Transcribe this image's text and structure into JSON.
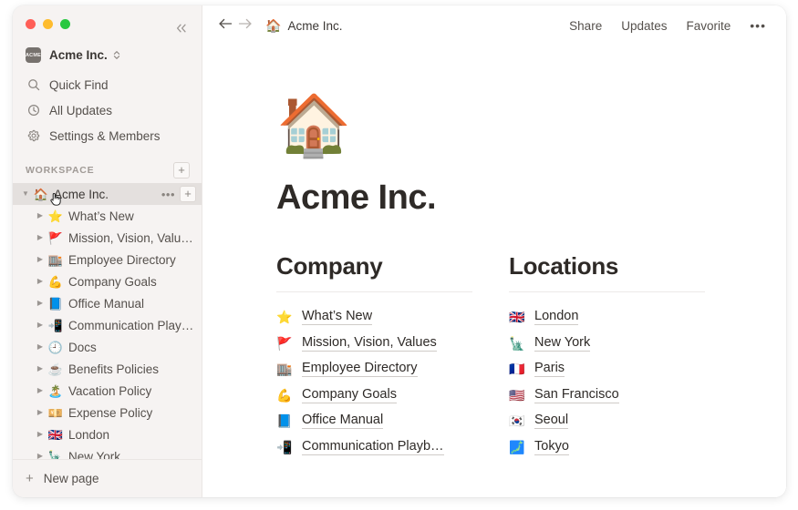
{
  "window": {
    "traffic_lights": [
      "close",
      "minimize",
      "maximize"
    ],
    "colors": {
      "close": "#FF5F57",
      "minimize": "#FEBC2E",
      "maximize": "#28C840",
      "sidebar_bg": "#F6F3F2",
      "main_bg": "#FFFFFF",
      "selected_row": "#E4E0DE",
      "text_primary": "#3B3734",
      "text_muted": "#A09A96"
    }
  },
  "sidebar": {
    "collapse_icon": "chevrons-left-icon",
    "workspace_switcher": {
      "badge_text": "ACME",
      "name": "Acme Inc.",
      "caret_icon": "chevron-up-down-icon"
    },
    "nav_items": [
      {
        "icon": "search-icon",
        "label": "Quick Find"
      },
      {
        "icon": "clock-icon",
        "label": "All Updates"
      },
      {
        "icon": "gear-icon",
        "label": "Settings & Members"
      }
    ],
    "section": {
      "title": "WORKSPACE",
      "add_label": "+"
    },
    "tree": [
      {
        "emoji": "🏠",
        "label": "Acme Inc.",
        "selected": true,
        "level": 0,
        "twisty": "▼",
        "actions": {
          "more": "•••",
          "add": "+"
        }
      },
      {
        "emoji": "⭐",
        "label": "What’s New",
        "selected": false,
        "level": 1,
        "twisty": "▶"
      },
      {
        "emoji": "🚩",
        "label": "Mission, Vision, Valu…",
        "selected": false,
        "level": 1,
        "twisty": "▶"
      },
      {
        "emoji": "🏬",
        "label": "Employee Directory",
        "selected": false,
        "level": 1,
        "twisty": "▶"
      },
      {
        "emoji": "💪",
        "label": "Company Goals",
        "selected": false,
        "level": 1,
        "twisty": "▶"
      },
      {
        "emoji": "📘",
        "label": "Office Manual",
        "selected": false,
        "level": 1,
        "twisty": "▶"
      },
      {
        "emoji": "📲",
        "label": "Communication Play…",
        "selected": false,
        "level": 1,
        "twisty": "▶"
      },
      {
        "emoji": "🕘",
        "label": "Docs",
        "selected": false,
        "level": 1,
        "twisty": "▶"
      },
      {
        "emoji": "☕",
        "label": "Benefits Policies",
        "selected": false,
        "level": 1,
        "twisty": "▶"
      },
      {
        "emoji": "🏝️",
        "label": "Vacation Policy",
        "selected": false,
        "level": 1,
        "twisty": "▶"
      },
      {
        "emoji": "💴",
        "label": "Expense Policy",
        "selected": false,
        "level": 1,
        "twisty": "▶"
      },
      {
        "emoji": "🇬🇧",
        "label": "London",
        "selected": false,
        "level": 1,
        "twisty": "▶"
      },
      {
        "emoji": "🗽",
        "label": "New York",
        "selected": false,
        "level": 1,
        "twisty": "▶"
      }
    ],
    "footer": {
      "icon": "plus-icon",
      "label": "New page"
    }
  },
  "topbar": {
    "back_icon": "arrow-left-icon",
    "forward_icon": "arrow-right-icon",
    "breadcrumb": {
      "emoji": "🏠",
      "label": "Acme Inc."
    },
    "actions": [
      "Share",
      "Updates",
      "Favorite"
    ],
    "more_icon": "•••"
  },
  "page": {
    "icon": "🏠",
    "title": "Acme Inc.",
    "columns": [
      {
        "heading": "Company",
        "links": [
          {
            "emoji": "⭐",
            "label": "What’s New"
          },
          {
            "emoji": "🚩",
            "label": "Mission, Vision, Values"
          },
          {
            "emoji": "🏬",
            "label": "Employee Directory"
          },
          {
            "emoji": "💪",
            "label": "Company Goals"
          },
          {
            "emoji": "📘",
            "label": "Office Manual"
          },
          {
            "emoji": "📲",
            "label": "Communication Playb…"
          }
        ]
      },
      {
        "heading": "Locations",
        "links": [
          {
            "emoji": "🇬🇧",
            "label": "London"
          },
          {
            "emoji": "🗽",
            "label": "New York"
          },
          {
            "emoji": "🇫🇷",
            "label": "Paris"
          },
          {
            "emoji": "🇺🇸",
            "label": "San Francisco"
          },
          {
            "emoji": "🇰🇷",
            "label": "Seoul"
          },
          {
            "emoji": "🗾",
            "label": "Tokyo"
          }
        ]
      }
    ]
  }
}
